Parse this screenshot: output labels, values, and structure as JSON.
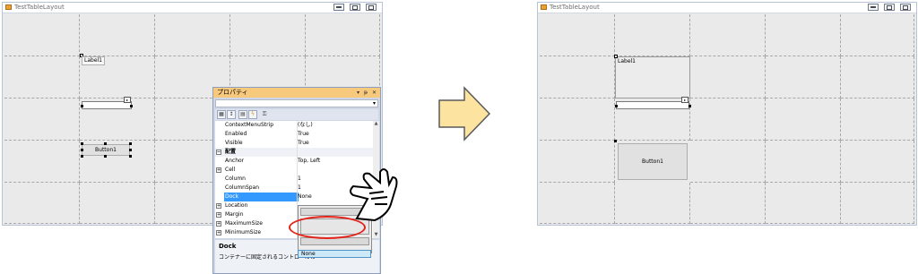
{
  "left_window": {
    "title": "TestTableLayout",
    "label": "Label1",
    "button": "Button1"
  },
  "right_window": {
    "title": "TestTableLayout",
    "label": "Label1",
    "button": "Button1"
  },
  "properties": {
    "title": "プロパティ",
    "title_buttons": [
      "▾",
      "ᵽ",
      "✕"
    ],
    "rows": [
      {
        "name": "ContextMenuStrip",
        "value": "(なし)",
        "type": "prop"
      },
      {
        "name": "Enabled",
        "value": "True",
        "type": "prop"
      },
      {
        "name": "Visible",
        "value": "True",
        "type": "prop"
      },
      {
        "name": "配置",
        "value": "",
        "type": "category"
      },
      {
        "name": "Anchor",
        "value": "Top, Left",
        "type": "prop"
      },
      {
        "name": "Cell",
        "value": "",
        "type": "expand"
      },
      {
        "name": "Column",
        "value": "1",
        "type": "prop"
      },
      {
        "name": "ColumnSpan",
        "value": "1",
        "type": "prop"
      },
      {
        "name": "Dock",
        "value": "None",
        "type": "selected"
      },
      {
        "name": "Location",
        "value": "",
        "type": "expand"
      },
      {
        "name": "Margin",
        "value": "",
        "type": "expand"
      },
      {
        "name": "MaximumSize",
        "value": "",
        "type": "expand"
      },
      {
        "name": "MinimumSize",
        "value": "",
        "type": "expand"
      }
    ],
    "dropdown_option": "None",
    "desc_title": "Dock",
    "desc_text": "コンテナーに固定されるコントロールの"
  },
  "colors": {
    "accent": "#3399ff",
    "arrow_fill": "#fde3a0",
    "highlight_circle": "#e2231a"
  },
  "icons": [
    "arrow-right-icon",
    "pointing-hand-icon"
  ]
}
